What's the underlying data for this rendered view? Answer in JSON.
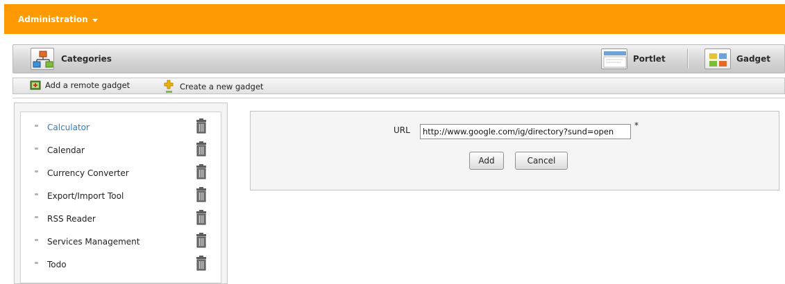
{
  "header": {
    "admin_label": "Administration"
  },
  "category_bar": {
    "title": "Categories",
    "portlet_label": "Portlet",
    "gadget_label": "Gadget"
  },
  "actions": {
    "add_remote": "Add a remote gadget",
    "create_new": "Create a new gadget"
  },
  "gadgets": [
    {
      "name": "Calculator",
      "active": true
    },
    {
      "name": "Calendar",
      "active": false
    },
    {
      "name": "Currency Converter",
      "active": false
    },
    {
      "name": "Export/Import Tool",
      "active": false
    },
    {
      "name": "RSS Reader",
      "active": false
    },
    {
      "name": "Services Management",
      "active": false
    },
    {
      "name": "Todo",
      "active": false
    }
  ],
  "form": {
    "url_label": "URL",
    "url_value": "http://www.google.com/ig/directory?sund=open",
    "required_mark": "*",
    "add_label": "Add",
    "cancel_label": "Cancel"
  },
  "colors": {
    "topbar": "#fd9902",
    "active_link": "#2a7fc6"
  }
}
